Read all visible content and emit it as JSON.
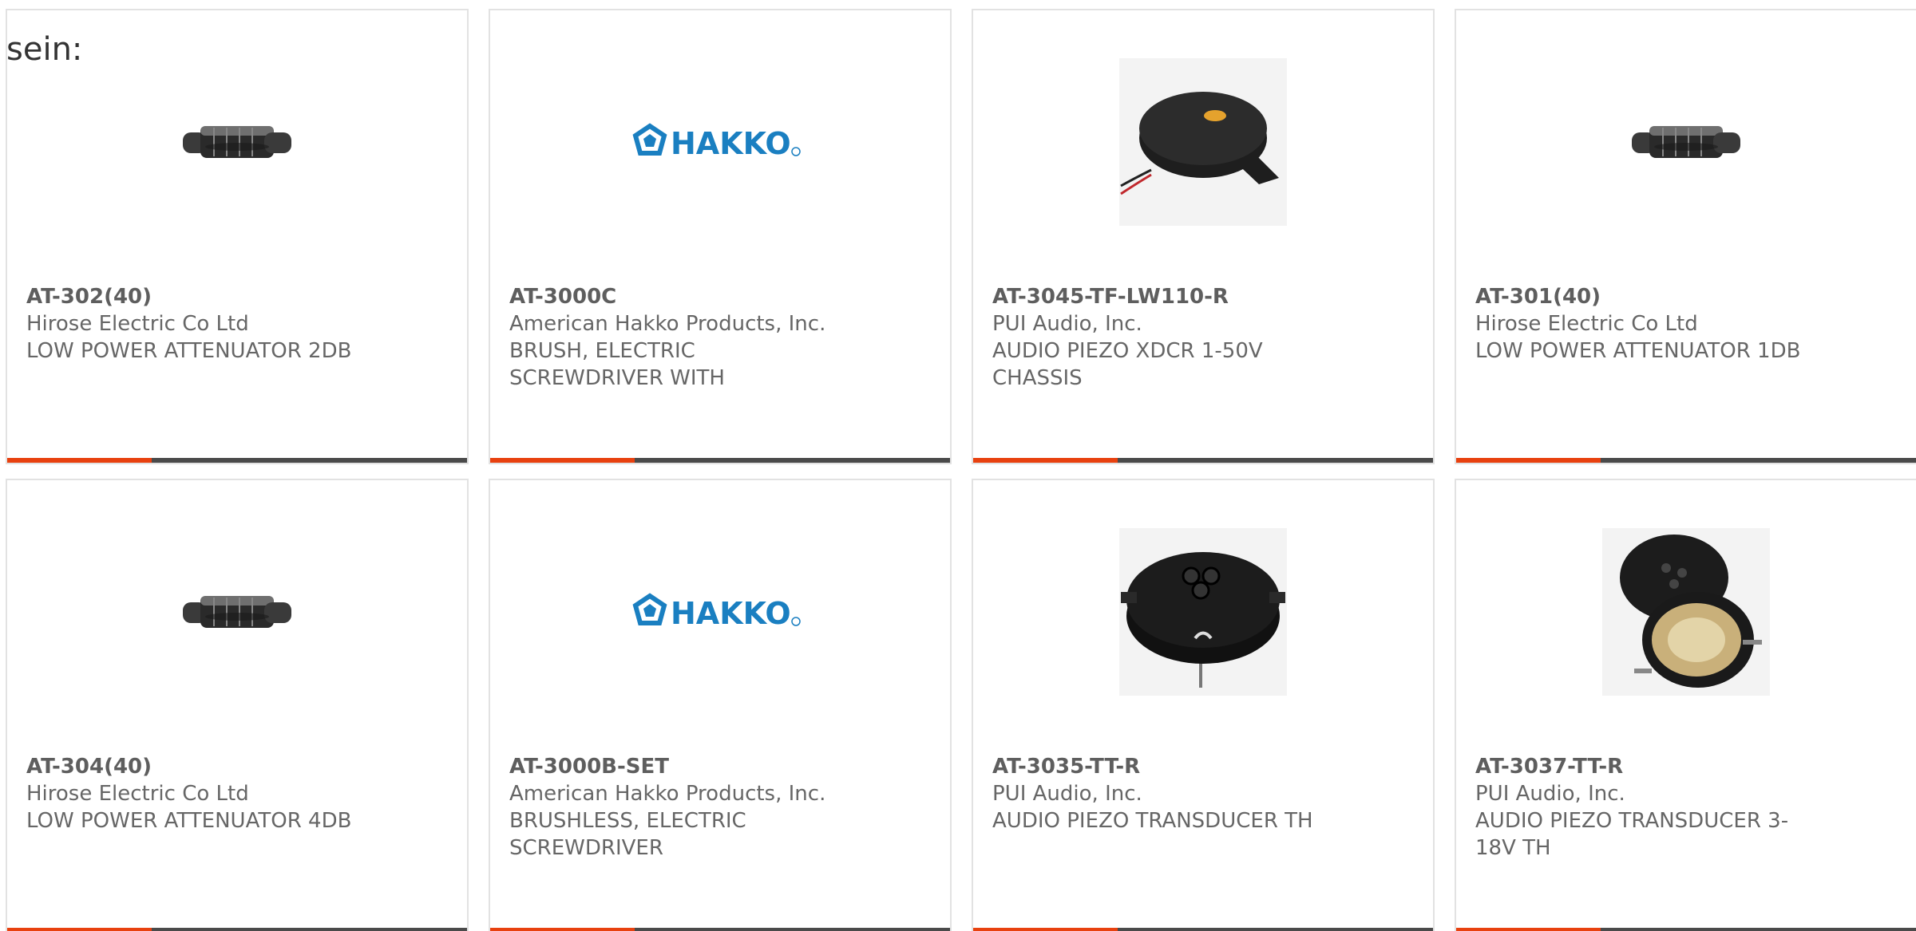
{
  "intro_text": "sein:",
  "colors": {
    "card_border": "#e2e2e2",
    "bar_dark": "#4a4a4a",
    "bar_accent": "#e8410f",
    "text": "#666666",
    "hakko_logo": "#1a7fc1"
  },
  "cards": [
    {
      "part_number": "AT-302(40)",
      "manufacturer": "Hirose Electric Co Ltd",
      "description": "LOW POWER ATTENUATOR 2DB",
      "image": "attenuator-icon"
    },
    {
      "part_number": "AT-3000C",
      "manufacturer": "American Hakko Products, Inc.",
      "description": "BRUSH, ELECTRIC SCREWDRIVER WITH",
      "image": "hakko-logo",
      "logo_text": "HAKKO"
    },
    {
      "part_number": "AT-3045-TF-LW110-R",
      "manufacturer": "PUI Audio, Inc.",
      "description": "AUDIO PIEZO XDCR 1-50V CHASSIS",
      "image": "piezo-chassis-icon"
    },
    {
      "part_number": "AT-301(40)",
      "manufacturer": "Hirose Electric Co Ltd",
      "description": "LOW POWER ATTENUATOR 1DB",
      "image": "attenuator-icon"
    },
    {
      "part_number": "AT-304(40)",
      "manufacturer": "Hirose Electric Co Ltd",
      "description": "LOW POWER ATTENUATOR 4DB",
      "image": "attenuator-icon"
    },
    {
      "part_number": "AT-3000B-SET",
      "manufacturer": "American Hakko Products, Inc.",
      "description": "BRUSHLESS, ELECTRIC SCREWDRIVER",
      "image": "hakko-logo",
      "logo_text": "HAKKO"
    },
    {
      "part_number": "AT-3035-TT-R",
      "manufacturer": "PUI Audio, Inc.",
      "description": "AUDIO PIEZO TRANSDUCER TH",
      "image": "piezo-transducer-icon"
    },
    {
      "part_number": "AT-3037-TT-R",
      "manufacturer": "PUI Audio, Inc.",
      "description": "AUDIO PIEZO TRANSDUCER 3-18V TH",
      "image": "piezo-transducer-pair-icon"
    }
  ]
}
